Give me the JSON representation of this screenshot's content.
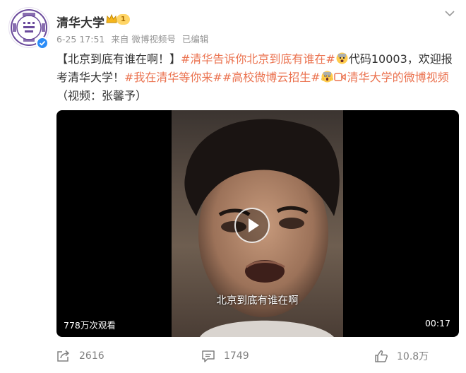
{
  "account": {
    "name": "清华大学",
    "level": "1",
    "avatar_icon": "tsinghua-seal-icon",
    "verified_icon": "verified-check-icon"
  },
  "meta": {
    "date": "6-25 17:51",
    "source": "来自 微博视频号",
    "edited": "已编辑"
  },
  "post": {
    "part1": "【北京到底有谁在啊！】",
    "tag1": "#清华告诉你北京到底有谁在#",
    "part2": "代码10003，欢迎报考清华大学！",
    "tag2": "#我在清华等你来#",
    "tag3": "#高校微博云招生#",
    "link": "清华大学的微博视频",
    "credit": "（视频：张馨予）"
  },
  "video": {
    "subtitle": "北京到底有谁在啊",
    "views": "778万次观看",
    "duration": "00:17"
  },
  "actions": {
    "reposts": "2616",
    "comments": "1749",
    "likes": "10.8万"
  },
  "colors": {
    "tag": "#eb7350",
    "verified": "#2b8cf7",
    "seal": "#6b4a9c"
  }
}
